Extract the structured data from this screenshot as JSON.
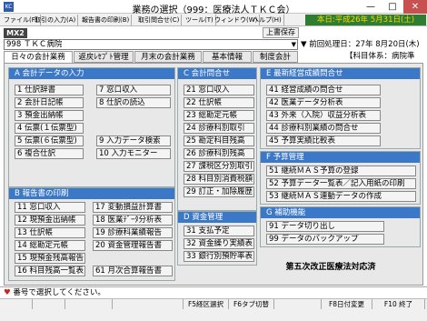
{
  "window": {
    "title": "業務の選択（999：医療法人ＴＫＣ会）",
    "icon_label": "KC",
    "min_glyph": "—",
    "max_glyph": "□",
    "close_glyph": "✕"
  },
  "menu": {
    "items": [
      "ファイル(F)",
      "取引の入力(A)",
      "報告書の印刷(B)",
      "取引問合せ(C)",
      "ツール(T)",
      "ウィンドウ(W)",
      "ヘルプ(H)"
    ],
    "date_label": "本日:平成26年 5月31日(土)"
  },
  "toolbar": {
    "badge": "MX2",
    "save_label": "上書保存",
    "client_value": "998 ＴＫＣ病院",
    "select_arrow": "▼",
    "last_processed": "▼ 前回処理日：27年 8月20日(木)"
  },
  "tabs": {
    "items": [
      "日々の会計業務",
      "返戻ﾚｾﾌﾟﾄ管理",
      "月末の会計業務",
      "基本情報",
      "制度会計"
    ],
    "right_label": "【科目体系：病院準則】"
  },
  "groups": {
    "a": {
      "header": "A  会計データの入力",
      "items": [
        "1 仕訳辞書",
        "2 会計日記帳",
        "3 預金出納帳",
        "4 伝票(１伝票型)",
        "5 伝票(６伝票型)",
        "6 複合仕訳",
        "7 窓口収入",
        "8 仕訳の読込",
        "9 入力データ検索",
        "10 入力モニター"
      ]
    },
    "b": {
      "header": "B  報告書の印刷",
      "items": [
        "11 窓口収入",
        "12 現預金出納帳",
        "13 仕訳帳",
        "14 総勘定元帳",
        "15 現預金残高報告",
        "16 科目残高一覧表",
        "17 変動損益計算書",
        "18 医業ﾃﾞｰﾀ分析表",
        "19 診療科業績報告",
        "20 資金管理報告書",
        "61 月次合算報告書"
      ]
    },
    "c": {
      "header": "C  会計問合せ",
      "items": [
        "21 窓口収入",
        "22 仕訳帳",
        "23 総勘定元帳",
        "24 診療科別取引",
        "25 勘定科目残高",
        "26 診療科別残高",
        "27 課税区分別取引",
        "28 科目別消費税額",
        "29 訂正・加除履歴"
      ]
    },
    "d": {
      "header": "D  資金管理",
      "items": [
        "31 支払予定",
        "32 資金繰り実績表",
        "33 銀行別預貯率表"
      ]
    },
    "e": {
      "header": "E  最新経営成績問合せ",
      "items": [
        "41 経営成績の問合せ",
        "42 医業データ分析表",
        "43 外来（入院）収益分析表",
        "44 診療科別業績の問合せ",
        "45 予算実績比較表"
      ]
    },
    "f": {
      "header": "F  予算管理",
      "items": [
        "51 継続ＭＡＳ予算の登録",
        "52 予算データ一覧表／記入用紙の印刷",
        "53 継続ＭＡＳ連動データの作成"
      ]
    },
    "g": {
      "header": "G  補助機能",
      "items": [
        "91 データ切り出し",
        "99 データのバックアップ"
      ]
    }
  },
  "notice": "第五次改正医療法対応済",
  "status": {
    "heart": "♥",
    "text": "番号で選択してください。"
  },
  "fkeys": [
    "",
    "",
    "",
    "",
    "F5経区選択",
    "F6タブ切替",
    "",
    "F8日付変更",
    "F10 終了"
  ]
}
